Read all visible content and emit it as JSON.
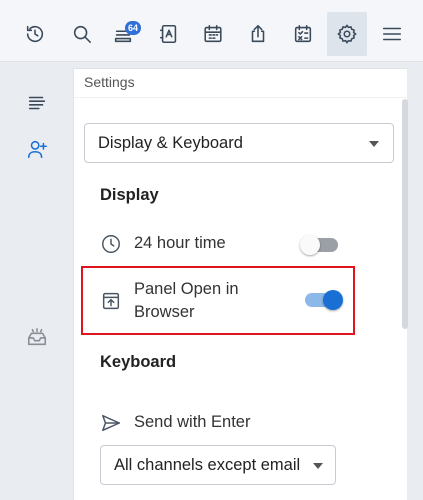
{
  "toolbar": {
    "items": [
      {
        "icon": "history-icon"
      },
      {
        "icon": "search-icon"
      },
      {
        "icon": "inbox-icon",
        "badge": "64"
      },
      {
        "icon": "contacts-icon"
      },
      {
        "icon": "calendar-icon"
      },
      {
        "icon": "share-icon"
      },
      {
        "icon": "tasks-icon"
      },
      {
        "icon": "gear-icon",
        "active": true
      },
      {
        "icon": "menu-icon"
      }
    ]
  },
  "left_rail": {
    "items": [
      {
        "icon": "list-icon"
      },
      {
        "icon": "add-user-icon"
      },
      {
        "icon": "tray-icon"
      }
    ]
  },
  "panel": {
    "title": "Settings",
    "category_select": "Display & Keyboard",
    "display": {
      "heading": "Display",
      "hour24": {
        "label": "24 hour time",
        "icon": "clock-icon",
        "enabled": false
      },
      "panel_open": {
        "label_line1": "Panel Open in",
        "label_line2": "Browser",
        "icon": "open-in-browser-icon",
        "enabled": true
      }
    },
    "keyboard": {
      "heading": "Keyboard",
      "send_with_enter": {
        "label": "Send with Enter",
        "icon": "send-icon"
      },
      "channels_select": "All channels except email"
    }
  },
  "colors": {
    "accent": "#1a6fd4",
    "highlight": "#e0141d"
  }
}
